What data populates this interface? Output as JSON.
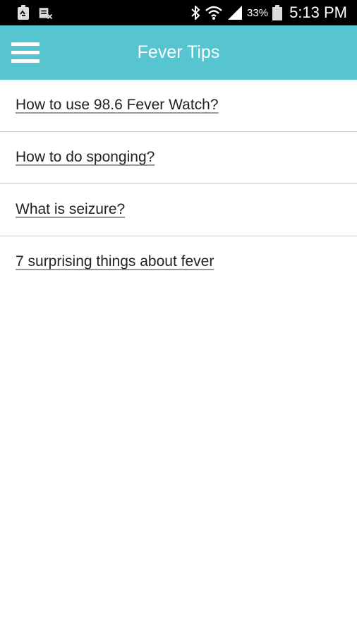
{
  "status_bar": {
    "battery_percent": "33%",
    "time": "5:13 PM",
    "icons": [
      "recycle-battery-icon",
      "image-x-icon",
      "bluetooth-icon",
      "wifi-icon",
      "signal-icon",
      "battery-icon"
    ]
  },
  "app_bar": {
    "title": "Fever Tips",
    "background_color": "#56c5d0",
    "menu_icon": "hamburger-menu-icon"
  },
  "tips": [
    {
      "label": "How to use 98.6 Fever Watch?"
    },
    {
      "label": "How to do sponging?"
    },
    {
      "label": "What is seizure?"
    },
    {
      "label": "7 surprising things about fever"
    }
  ]
}
